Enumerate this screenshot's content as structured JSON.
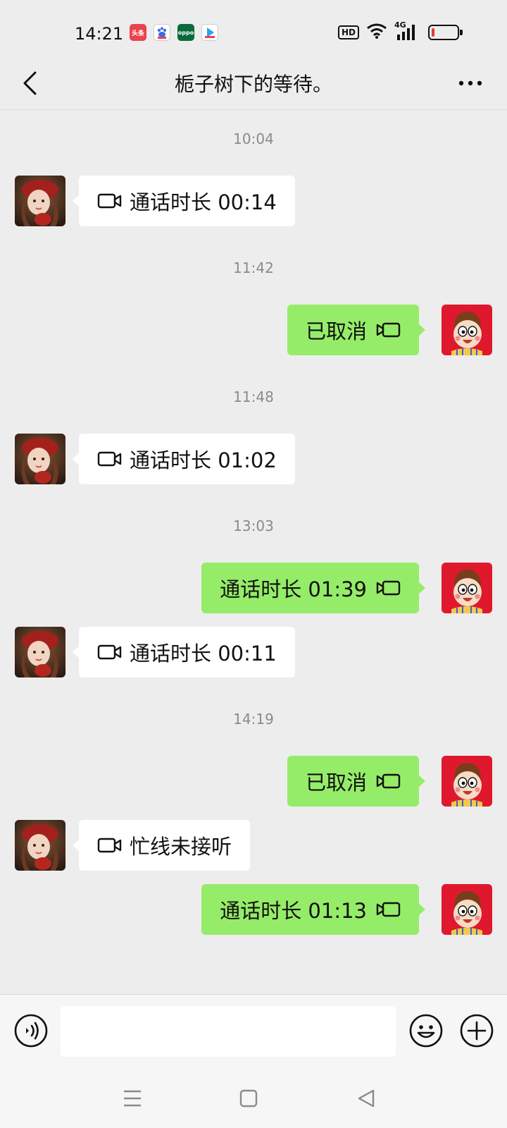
{
  "status_bar": {
    "time": "14:21",
    "hd_label": "HD",
    "network": "4G",
    "battery_level": 0.12,
    "apps": [
      {
        "name": "toutiao",
        "label": "头条",
        "color": "#e8434f"
      },
      {
        "name": "baidu",
        "label": "",
        "color": "#3b6de0"
      },
      {
        "name": "oppo",
        "label": "oppo",
        "color": "#0a6b3a"
      },
      {
        "name": "video",
        "label": "",
        "color": "#2aa3f5"
      }
    ]
  },
  "header": {
    "title": "栀子树下的等待。"
  },
  "messages": [
    {
      "type": "time",
      "text": "10:04"
    },
    {
      "type": "call",
      "side": "left",
      "text": "通话时长 00:14"
    },
    {
      "type": "time",
      "text": "11:42"
    },
    {
      "type": "call",
      "side": "right",
      "text": "已取消"
    },
    {
      "type": "time",
      "text": "11:48"
    },
    {
      "type": "call",
      "side": "left",
      "text": "通话时长 01:02"
    },
    {
      "type": "time",
      "text": "13:03"
    },
    {
      "type": "call",
      "side": "right",
      "text": "通话时长 01:39"
    },
    {
      "type": "call",
      "side": "left",
      "text": "通话时长 00:11"
    },
    {
      "type": "time",
      "text": "14:19"
    },
    {
      "type": "call",
      "side": "right",
      "text": "已取消"
    },
    {
      "type": "call",
      "side": "left",
      "text": "忙线未接听"
    },
    {
      "type": "call",
      "side": "right",
      "text": "通话时长 01:13"
    }
  ],
  "input": {
    "value": "",
    "placeholder": ""
  },
  "colors": {
    "bubble_sent": "#95ec69",
    "bubble_received": "#ffffff",
    "background": "#ededed"
  }
}
